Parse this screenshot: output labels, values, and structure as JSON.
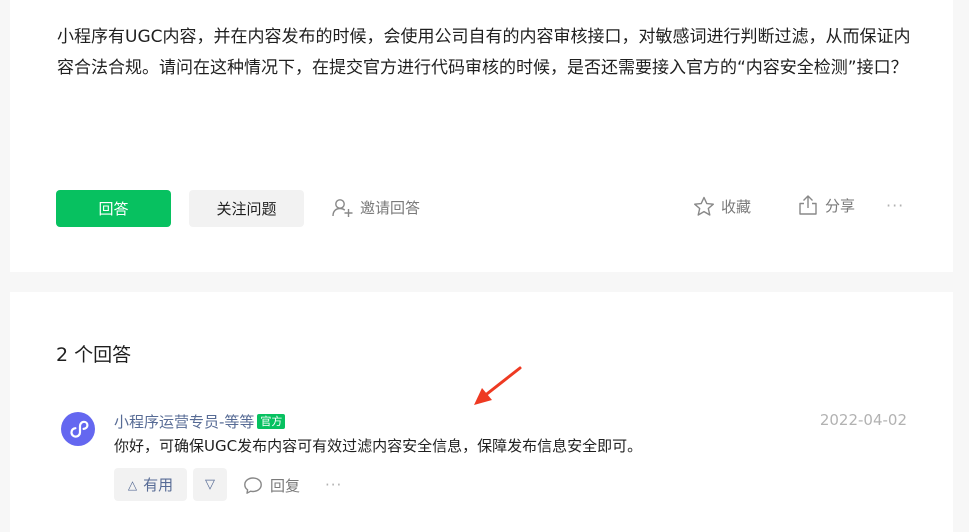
{
  "question": {
    "text": "小程序有UGC内容，并在内容发布的时候，会使用公司自有的内容审核接口，对敏感词进行判断过滤，从而保证内容合法合规。请问在这种情况下，在提交官方进行代码审核的时候，是否还需要接入官方的“内容安全检测”接口？",
    "answer_button": "回答",
    "follow_button": "关注问题",
    "invite_label": "邀请回答",
    "collect_label": "收藏",
    "share_label": "分享",
    "more_label": "···"
  },
  "answers": {
    "count_label": "2 个回答",
    "items": [
      {
        "author": "小程序运营专员-等等",
        "badge": "官方",
        "date": "2022-04-02",
        "text": "你好，可确保UGC发布内容可有效过滤内容安全信息，保障发布信息安全即可。",
        "useful_label": "有用",
        "reply_label": "回复",
        "more_label": "···"
      }
    ]
  },
  "colors": {
    "primary": "#07c160",
    "link": "#576b95",
    "avatar": "#6467f0",
    "annotation_arrow": "#ee3a22"
  },
  "icons": {
    "invite": "add-user-icon",
    "collect": "star-icon",
    "share": "share-icon",
    "reply": "comment-icon",
    "avatar": "miniprogram-logo-icon"
  }
}
